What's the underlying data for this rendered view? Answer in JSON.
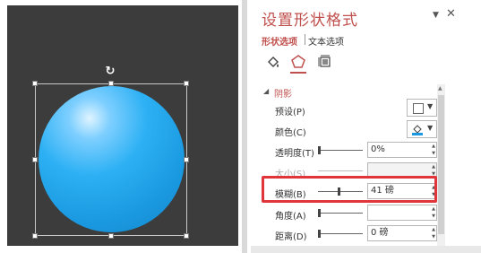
{
  "panel": {
    "title": "设置形状格式",
    "pin_symbol": "▼",
    "close_symbol": "✕",
    "tabs": {
      "shape_options": "形状选项",
      "text_options": "文本选项"
    },
    "section": {
      "arrow": "◢",
      "title": "阴影"
    },
    "rows": {
      "preset": {
        "label": "预设(P)"
      },
      "color": {
        "label": "颜色(C)"
      },
      "transparency": {
        "label": "透明度(T)",
        "value": "0%"
      },
      "size": {
        "label": "大小(S)",
        "value": ""
      },
      "blur": {
        "label": "模糊(B)",
        "value": "41 磅"
      },
      "angle": {
        "label": "角度(A)",
        "value": ""
      },
      "distance": {
        "label": "距离(D)",
        "value": "0 磅"
      }
    },
    "icons": [
      "fill-line-icon",
      "effects-icon",
      "size-properties-icon"
    ],
    "accent_color": "#c0504d",
    "highlight_color": "#e0353a"
  },
  "canvas": {
    "shape": "circle",
    "fill_color": "#1a99e0",
    "background": "#3c3c3c"
  }
}
